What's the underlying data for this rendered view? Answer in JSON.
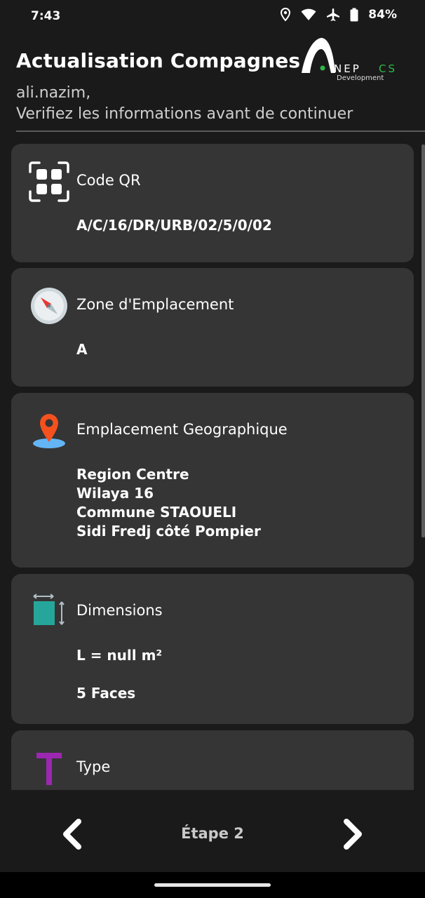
{
  "status": {
    "time": "7:43",
    "battery": "84%"
  },
  "header": {
    "title": "Actualisation Compagnes",
    "user": "ali.nazim,",
    "instruction": "Verifiez les informations avant de continuer"
  },
  "logo": {
    "wordmark": "NEPCS",
    "sub": "Development"
  },
  "cards": {
    "qr": {
      "label": "Code QR",
      "value": "A/C/16/DR/URB/02/5/0/02"
    },
    "zone": {
      "label": "Zone d'Emplacement",
      "value": "A"
    },
    "location": {
      "label": "Emplacement Geographique",
      "lines": [
        "Region Centre",
        "Wilaya 16",
        "Commune STAOUELI",
        "Sidi Fredj côté Pompier"
      ]
    },
    "dimensions": {
      "label": "Dimensions",
      "area": "L = null m²",
      "faces": "5 Faces"
    },
    "type": {
      "label": "Type"
    }
  },
  "footer": {
    "step": "Étape 2"
  },
  "colors": {
    "background": "#1a1a1a",
    "card": "#353535",
    "accent_green": "#2db84a",
    "pin": "#f4511e",
    "type_icon": "#9c27b0",
    "teal": "#26a69a"
  }
}
